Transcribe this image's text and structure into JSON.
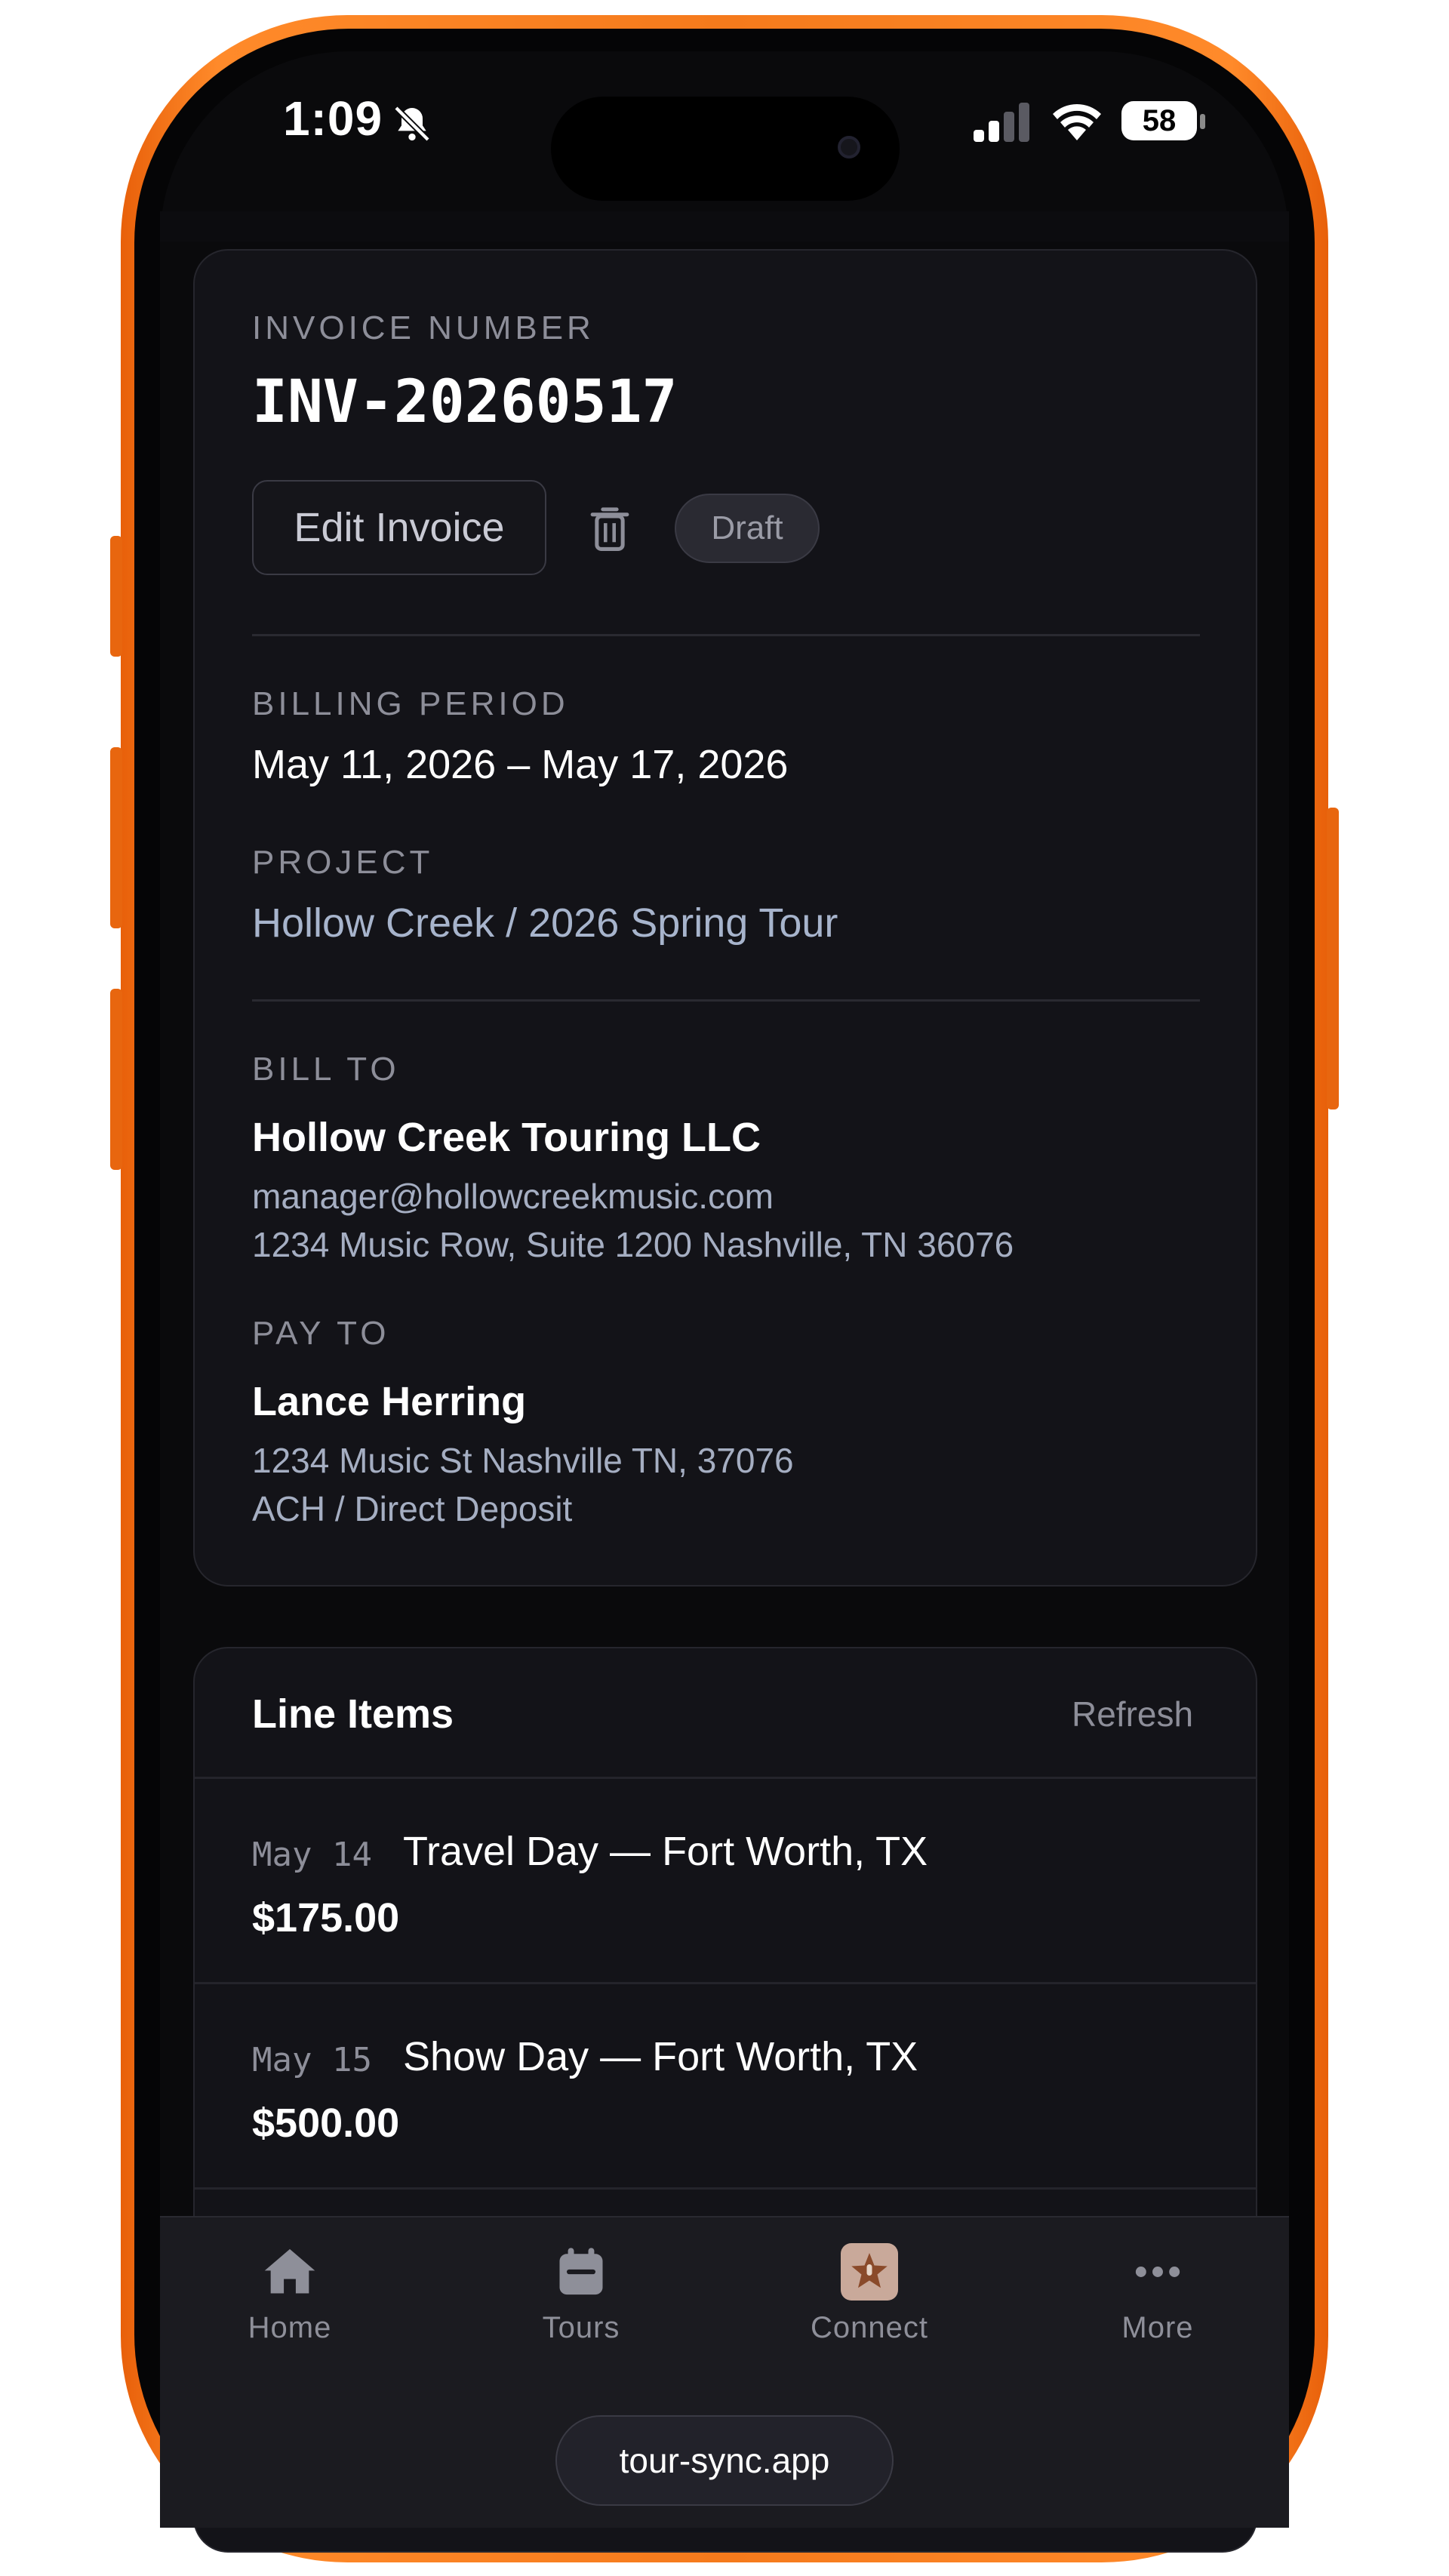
{
  "status_bar": {
    "time": "1:09",
    "battery": "58",
    "icons": [
      "bell-slash-icon",
      "signal-icon",
      "wifi-icon",
      "battery-icon"
    ]
  },
  "invoice": {
    "number_label": "INVOICE NUMBER",
    "number": "INV-20260517",
    "edit_label": "Edit Invoice",
    "status_badge": "Draft",
    "billing_period_label": "BILLING PERIOD",
    "billing_period": "May 11, 2026 – May 17, 2026",
    "project_label": "PROJECT",
    "project": "Hollow Creek / 2026 Spring Tour",
    "bill_to_label": "BILL TO",
    "bill_to": {
      "name": "Hollow Creek Touring LLC",
      "email": "manager@hollowcreekmusic.com",
      "address": "1234 Music Row, Suite 1200 Nashville, TN 36076"
    },
    "pay_to_label": "PAY TO",
    "pay_to": {
      "name": "Lance Herring",
      "address": "1234 Music St Nashville TN, 37076",
      "method": "ACH / Direct Deposit"
    }
  },
  "line_items": {
    "title": "Line Items",
    "refresh_label": "Refresh",
    "items": [
      {
        "date": "May 14",
        "description": "Travel Day — Fort Worth, TX",
        "amount": "$175.00"
      },
      {
        "date": "May 15",
        "description": "Show Day — Fort Worth, TX",
        "amount": "$500.00"
      }
    ]
  },
  "tabbar": {
    "tabs": [
      {
        "label": "Home",
        "icon": "home-icon"
      },
      {
        "label": "Tours",
        "icon": "calendar-icon"
      },
      {
        "label": "Connect",
        "icon": "connect-icon"
      },
      {
        "label": "More",
        "icon": "more-icon"
      }
    ]
  },
  "browser": {
    "url": "tour-sync.app"
  },
  "colors": {
    "phone_frame": "#f57a1c",
    "background": "#0a0a0c",
    "card": "#131318",
    "accent_text": "#a7b4cc"
  }
}
